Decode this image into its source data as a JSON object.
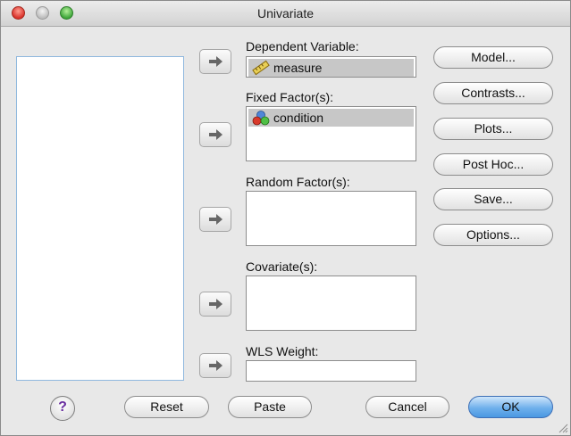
{
  "window": {
    "title": "Univariate"
  },
  "dependent_variable": {
    "label": "Dependent Variable:",
    "value": "measure",
    "icon": "ruler-icon"
  },
  "fixed_factors": {
    "label": "Fixed Factor(s):",
    "items": [
      "condition"
    ],
    "icon": "nominal-circles-icon"
  },
  "random_factors": {
    "label": "Random Factor(s):",
    "items": []
  },
  "covariates": {
    "label": "Covariate(s):",
    "items": []
  },
  "wls_weight": {
    "label": "WLS Weight:",
    "value": ""
  },
  "side_buttons": {
    "model": "Model...",
    "contrasts": "Contrasts...",
    "plots": "Plots...",
    "post_hoc": "Post Hoc...",
    "save": "Save...",
    "options": "Options..."
  },
  "bottom_buttons": {
    "help": "?",
    "reset": "Reset",
    "paste": "Paste",
    "cancel": "Cancel",
    "ok": "OK"
  },
  "colors": {
    "ok_blue": "#4a98e2",
    "selection_gray": "#c7c7c7",
    "list_border": "#8fb8de"
  }
}
